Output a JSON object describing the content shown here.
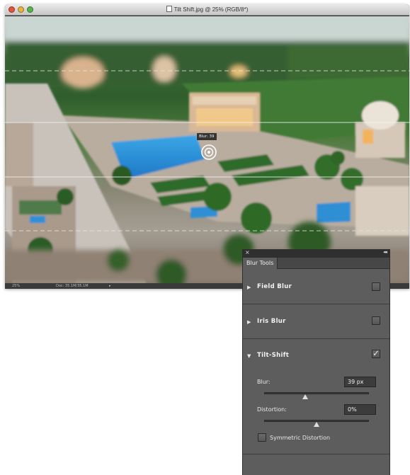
{
  "window": {
    "title": "Tilt Shift.jpg @ 25% (RGB/8*)"
  },
  "canvas": {
    "pin_label": "Blur: 39"
  },
  "status_bar": {
    "zoom": "25%",
    "doc_info": "Doc: 35.1M/35.1M"
  },
  "panel": {
    "tab": "Blur Tools",
    "sections": [
      {
        "label": "Field Blur",
        "expanded": false,
        "checked": false
      },
      {
        "label": "Iris Blur",
        "expanded": false,
        "checked": false
      },
      {
        "label": "Tilt-Shift",
        "expanded": true,
        "checked": true
      }
    ],
    "tilt_shift": {
      "blur_label": "Blur:",
      "blur_value": "39 px",
      "blur_slider_fraction": 0.39,
      "distortion_label": "Distortion:",
      "distortion_value": "0%",
      "distortion_slider_fraction": 0.5,
      "symmetric_label": "Symmetric Distortion",
      "symmetric_checked": false
    }
  },
  "icons": {
    "collapse": "double-chevron-right",
    "expanded_triangle": "▼",
    "collapsed_triangle": "▶"
  }
}
